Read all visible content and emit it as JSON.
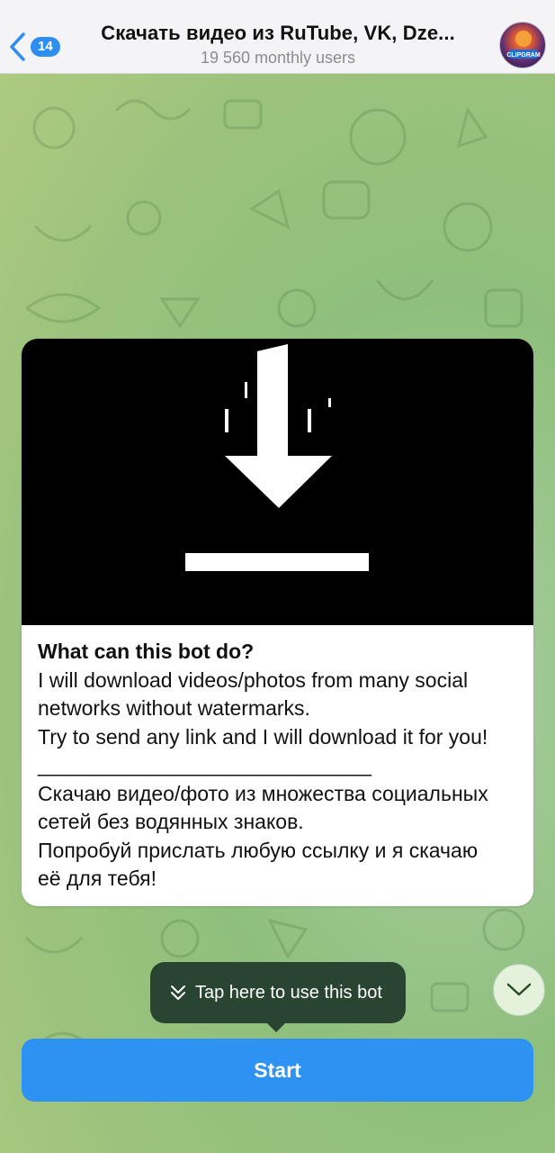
{
  "header": {
    "back_badge": "14",
    "title": "Скачать видео из RuTube, VK, Dze...",
    "subtitle": "19 560 monthly users",
    "avatar_text": "CLIPGRAM"
  },
  "card": {
    "title": "What can this bot do?",
    "lines": [
      "I will download videos/photos from many social",
      "networks without watermarks.",
      "Try to send any link and I will download it for you!",
      "_____________________________",
      "Скачаю видео/фото из множества социальных",
      "сетей без водянных знаков.",
      "Попробуй прислать любую ссылку и я скачаю",
      "её для тебя!"
    ]
  },
  "tooltip": {
    "text": "Tap here to use this bot",
    "icon": "double-chevron-down-icon"
  },
  "start": {
    "label": "Start"
  },
  "colors": {
    "accent": "#2e92f2",
    "tooltip_bg": "#2a4432",
    "header_bg": "#f4f4f6"
  }
}
